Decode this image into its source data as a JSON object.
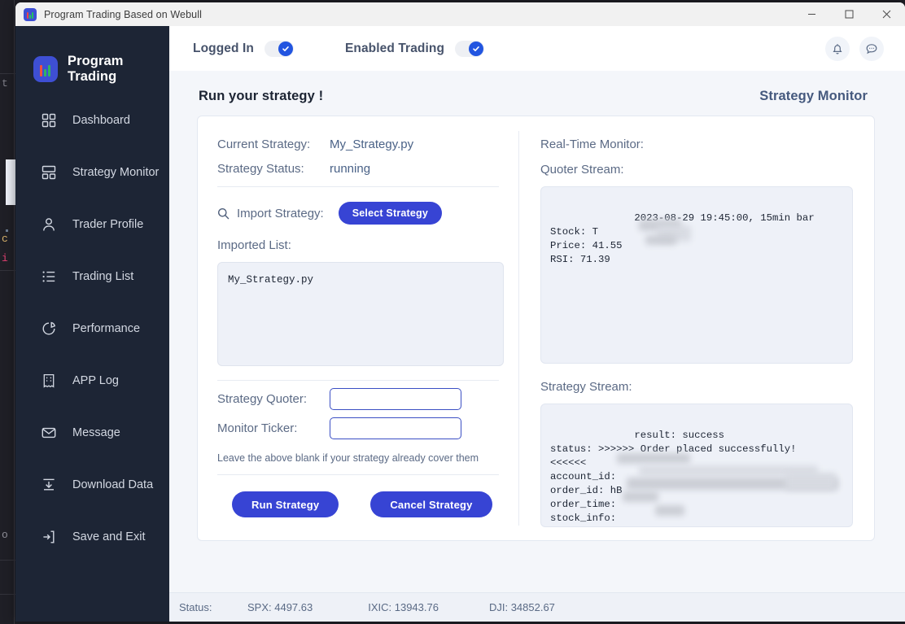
{
  "window": {
    "title": "Program Trading Based on Webull",
    "icon": "app-logo-icon",
    "controls": {
      "minimize": "minimize",
      "maximize": "maximize",
      "close": "close"
    }
  },
  "sidebar": {
    "brand": "Program Trading",
    "items": [
      {
        "label": "Dashboard",
        "icon": "grid-icon",
        "active": false
      },
      {
        "label": "Strategy Monitor",
        "icon": "layout-icon",
        "active": true
      },
      {
        "label": "Trader Profile",
        "icon": "user-icon",
        "active": false
      },
      {
        "label": "Trading List",
        "icon": "list-icon",
        "active": false
      },
      {
        "label": "Performance",
        "icon": "pie-chart-icon",
        "active": false
      },
      {
        "label": "APP Log",
        "icon": "receipt-icon",
        "active": false
      },
      {
        "label": "Message",
        "icon": "envelope-icon",
        "active": false
      },
      {
        "label": "Download Data",
        "icon": "download-icon",
        "active": false
      },
      {
        "label": "Save and Exit",
        "icon": "logout-icon",
        "active": false
      }
    ]
  },
  "topbar": {
    "toggles": [
      {
        "label": "Logged In",
        "on": true
      },
      {
        "label": "Enabled Trading",
        "on": true
      }
    ],
    "actions": [
      {
        "icon": "bell-icon"
      },
      {
        "icon": "chat-icon"
      }
    ]
  },
  "page": {
    "title": "Run your strategy !",
    "section_title": "Strategy Monitor"
  },
  "strategy": {
    "current_strategy_label": "Current Strategy:",
    "current_strategy_value": "My_Strategy.py",
    "status_label": "Strategy Status:",
    "status_value": "running",
    "import_label": "Import Strategy:",
    "select_strategy_button": "Select Strategy",
    "imported_list_label": "Imported List:",
    "imported_list_items": "My_Strategy.py",
    "quoter_label": "Strategy Quoter:",
    "quoter_value": "",
    "quoter_placeholder": "",
    "ticker_label": "Monitor Ticker:",
    "ticker_value": "",
    "ticker_placeholder": "",
    "hint": "Leave the above blank if your strategy already cover them",
    "run_button": "Run Strategy",
    "cancel_button": "Cancel Strategy"
  },
  "monitor": {
    "title": "Real-Time Monitor:",
    "quoter_stream_label": "Quoter Stream:",
    "quoter_stream_text": "2023-08-29 19:45:00, 15min bar\nStock: T\nPrice: 41.55\nRSI: 71.39",
    "strategy_stream_label": "Strategy Stream:",
    "strategy_stream_text": "result: success\nstatus: >>>>>> Order placed successfully!\n<<<<<<\naccount_id:\norder_id: hB\norder_time:\nstock_info:\norder_direction:"
  },
  "statusbar": {
    "label": "Status:",
    "tickers": [
      {
        "text": "SPX: 4497.63"
      },
      {
        "text": "IXIC: 13943.76"
      },
      {
        "text": "DJI: 34852.67"
      }
    ]
  },
  "background": {
    "fragments": [
      "t",
      "c",
      "i",
      "o"
    ]
  },
  "colors": {
    "accent": "#3744d4",
    "sidebar": "#1d2535",
    "page_bg": "#f4f6fa",
    "panel_bg": "#eef1f8"
  }
}
